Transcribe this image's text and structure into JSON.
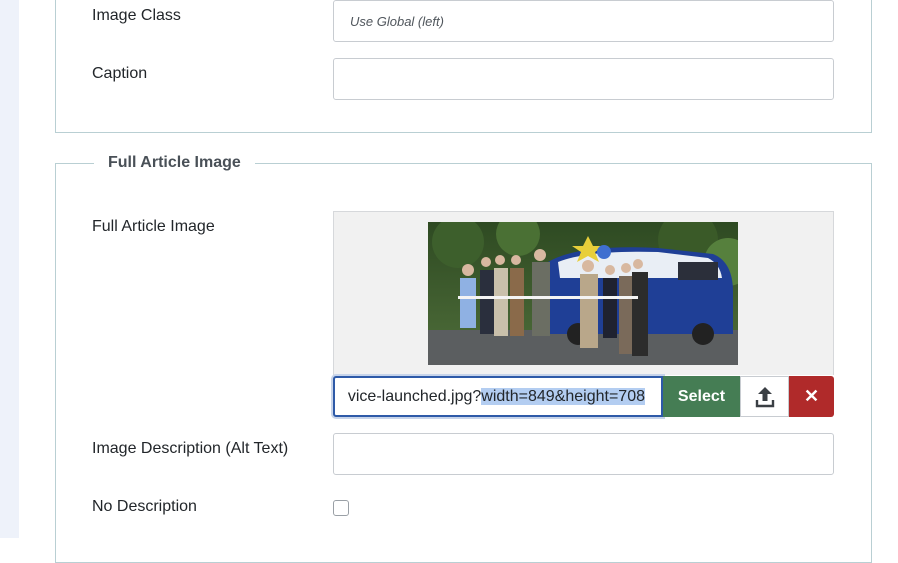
{
  "image_class": {
    "label": "Image Class",
    "placeholder": "Use Global (left)"
  },
  "caption": {
    "label": "Caption",
    "value": ""
  },
  "full_article_section": {
    "legend": "Full Article Image"
  },
  "full_image": {
    "label": "Full Article Image",
    "url_visible_prefix": "vice-launched.jpg?",
    "url_selected_suffix": "width=849&height=708",
    "select_label": "Select",
    "upload_icon": "upload-icon",
    "clear_icon": "close-icon",
    "clear_glyph": "✕"
  },
  "alt_text": {
    "label": "Image Description (Alt Text)",
    "value": ""
  },
  "no_description": {
    "label": "No Description",
    "checked": false
  },
  "colors": {
    "select_button": "#457d54",
    "clear_button": "#b02a2a",
    "focus_border": "#2e5aa8",
    "fieldset_border": "#b9cfd3"
  }
}
